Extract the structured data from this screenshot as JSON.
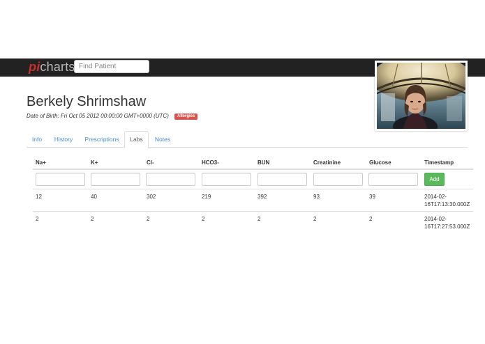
{
  "navbar": {
    "brand_pi": "pi",
    "brand_rest": "charts",
    "search_placeholder": "Find Patient"
  },
  "patient": {
    "name": "Berkely Shrimshaw",
    "dob": "Date of Birth: Fri Oct 05 2012 00:00:00 GMT+0000 (UTC)",
    "allergies_badge": "Allergies"
  },
  "tabs": [
    {
      "label": "Info",
      "active": false
    },
    {
      "label": "History",
      "active": false
    },
    {
      "label": "Prescriptions",
      "active": false
    },
    {
      "label": "Labs",
      "active": true
    },
    {
      "label": "Notes",
      "active": false
    }
  ],
  "labs": {
    "columns": [
      "Na+",
      "K+",
      "Cl-",
      "HCO3-",
      "BUN",
      "Creatinine",
      "Glucose",
      "Timestamp"
    ],
    "add_label": "Add",
    "rows": [
      {
        "values": [
          "12",
          "40",
          "302",
          "219",
          "392",
          "93",
          "39"
        ],
        "ts_line1": "2014-02-",
        "ts_line2": "16T17:13:30.000Z"
      },
      {
        "values": [
          "2",
          "2",
          "2",
          "2",
          "2",
          "2",
          "2"
        ],
        "ts_line1": "2014-02-",
        "ts_line2": "16T17:27:53.000Z"
      }
    ]
  },
  "colors": {
    "navbar": "#222222",
    "link": "#428bca",
    "danger": "#d9534f",
    "success": "#5cb85c"
  }
}
